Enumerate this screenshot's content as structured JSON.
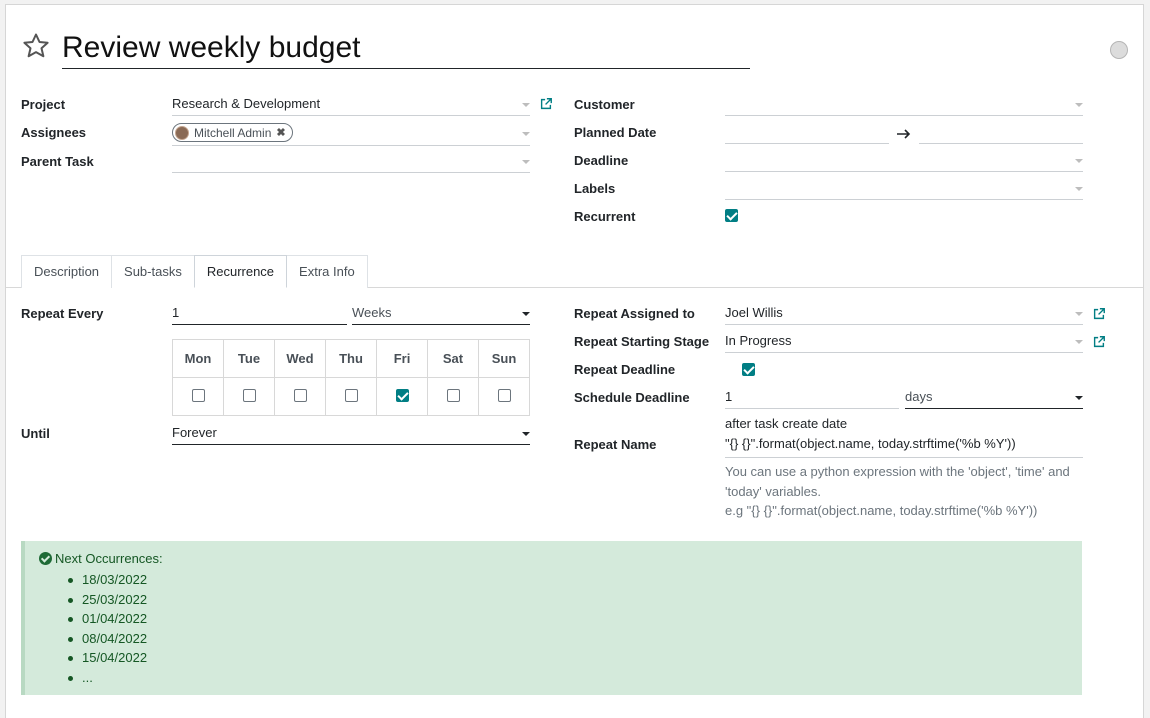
{
  "title": "Review weekly budget",
  "left_fields": {
    "project_label": "Project",
    "project_value": "Research & Development",
    "assignees_label": "Assignees",
    "assignee_tag": "Mitchell Admin",
    "parent_task_label": "Parent Task",
    "parent_task_value": ""
  },
  "right_fields": {
    "customer_label": "Customer",
    "customer_value": "",
    "planned_date_label": "Planned Date",
    "deadline_label": "Deadline",
    "labels_label": "Labels",
    "recurrent_label": "Recurrent",
    "recurrent_checked": true
  },
  "tabs": [
    {
      "label": "Description",
      "active": false
    },
    {
      "label": "Sub-tasks",
      "active": false
    },
    {
      "label": "Recurrence",
      "active": true
    },
    {
      "label": "Extra Info",
      "active": false
    }
  ],
  "recurrence": {
    "repeat_every_label": "Repeat Every",
    "repeat_every_value": "1",
    "repeat_unit": "Weeks",
    "days": [
      "Mon",
      "Tue",
      "Wed",
      "Thu",
      "Fri",
      "Sat",
      "Sun"
    ],
    "days_checked": [
      false,
      false,
      false,
      false,
      true,
      false,
      false
    ],
    "until_label": "Until",
    "until_value": "Forever",
    "repeat_assigned_label": "Repeat Assigned to",
    "repeat_assigned_value": "Joel Willis",
    "repeat_stage_label": "Repeat Starting Stage",
    "repeat_stage_value": "In Progress",
    "repeat_deadline_label": "Repeat Deadline",
    "repeat_deadline_checked": true,
    "schedule_deadline_label": "Schedule Deadline",
    "schedule_deadline_value": "1",
    "schedule_deadline_unit": "days",
    "schedule_deadline_hint": "after task create date",
    "repeat_name_label": "Repeat Name",
    "repeat_name_value": "\"{} {}\".format(object.name, today.strftime('%b %Y'))",
    "help_line1": "You can use a python expression with the 'object', 'time' and",
    "help_line2": "'today' variables.",
    "help_line3": "e.g \"{} {}\".format(object.name, today.strftime('%b %Y'))"
  },
  "next_occurrences": {
    "heading": "Next Occurrences:",
    "items": [
      "18/03/2022",
      "25/03/2022",
      "01/04/2022",
      "08/04/2022",
      "15/04/2022",
      "..."
    ]
  },
  "colors": {
    "accent": "#017e84",
    "alert_bg": "#d4eadb",
    "alert_text": "#155724"
  }
}
